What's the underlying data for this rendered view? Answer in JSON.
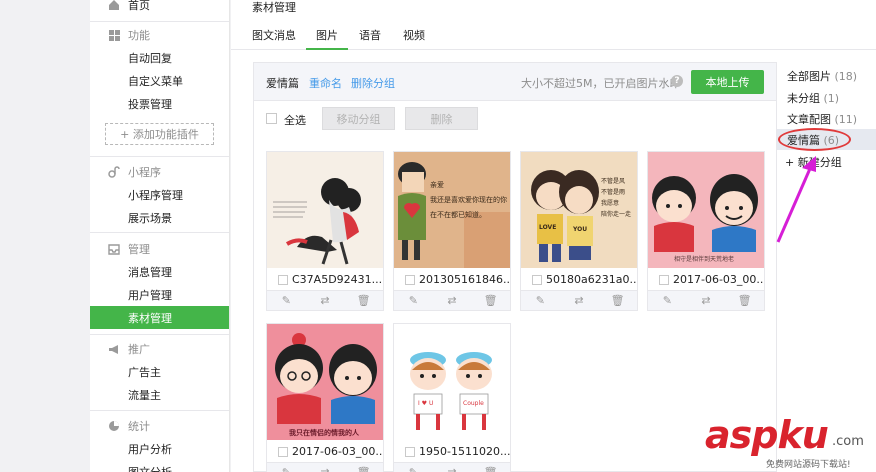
{
  "sidebar": {
    "home_label": "首页",
    "features_label": "功能",
    "feature_items": [
      "自动回复",
      "自定义菜单",
      "投票管理"
    ],
    "add_plugin_label": "+ 添加功能插件",
    "miniprogram_label": "小程序",
    "miniprogram_items": [
      "小程序管理",
      "展示场景"
    ],
    "manage_label": "管理",
    "manage_items": [
      "消息管理",
      "用户管理",
      "素材管理"
    ],
    "promo_label": "推广",
    "promo_items": [
      "广告主",
      "流量主"
    ],
    "stats_label": "统计",
    "stats_items": [
      "用户分析",
      "图文分析"
    ]
  },
  "main": {
    "title": "素材管理",
    "tabs": [
      "图文消息",
      "图片",
      "语音",
      "视频"
    ],
    "active_tab": "图片"
  },
  "toolbar": {
    "group_name": "爱情篇",
    "rename_label": "重命名",
    "delete_group_label": "删除分组",
    "hint": "大小不超过5M，已开启图片水印",
    "help": "?",
    "upload_label": "本地上传"
  },
  "actions": {
    "select_all_label": "全选",
    "move_group_label": "移动分组",
    "delete_label": "删除"
  },
  "images": [
    {
      "name": "C37A5D92431..."
    },
    {
      "name": "201305161846..."
    },
    {
      "name": "50180a6231a0..."
    },
    {
      "name": "2017-06-03_00..."
    },
    {
      "name": "2017-06-03_00..."
    },
    {
      "name": "1950-1511020..."
    }
  ],
  "thumbnail_texts": {
    "img2": "亲爱\n我还是喜欢爱你现在的你\n在不在都已知道。",
    "img3": "不管是风\n不管是雨\n我愿意\n陪你走一走",
    "img3_shirts": [
      "LOVE",
      "YOU"
    ],
    "img4": "相守是相伴到天荒地老",
    "img5": "我只在情侣的情我的人",
    "img6_cards": [
      "I ♥ U",
      "Couple"
    ]
  },
  "categories": [
    {
      "label": "全部图片",
      "count": "(18)"
    },
    {
      "label": "未分组",
      "count": "(1)"
    },
    {
      "label": "文章配图",
      "count": "(11)"
    },
    {
      "label": "爱情篇",
      "count": "(6)"
    }
  ],
  "new_group_label": "+ 新建分组",
  "watermark": {
    "logo": "aspku",
    "domain": ".com",
    "subtitle": "免费网站源码下载站!"
  },
  "colors": {
    "accent": "#44b549",
    "link": "#459ae9",
    "highlight_circle": "#e03a3a",
    "arrow": "#d61ed6"
  }
}
